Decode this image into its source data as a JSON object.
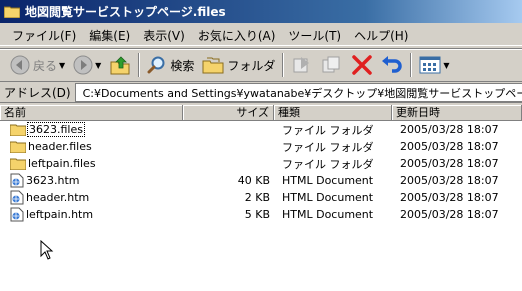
{
  "window": {
    "title": "地図閲覧サービストップページ.files"
  },
  "menu": [
    {
      "label": "ファイル(F)"
    },
    {
      "label": "編集(E)"
    },
    {
      "label": "表示(V)"
    },
    {
      "label": "お気に入り(A)"
    },
    {
      "label": "ツール(T)"
    },
    {
      "label": "ヘルプ(H)"
    }
  ],
  "toolbar": {
    "back_label": "戻る",
    "search_label": "検索",
    "folder_label": "フォルダ"
  },
  "address": {
    "label": "アドレス(D)",
    "path": "C:¥Documents and Settings¥ywatanabe¥デスクトップ¥地図閲覧サービストップページ.files"
  },
  "columns": {
    "name": "名前",
    "size": "サイズ",
    "type": "種類",
    "modified": "更新日時"
  },
  "files": [
    {
      "name": "3623.files",
      "size": "",
      "type": "ファイル フォルダ",
      "modified": "2005/03/28 18:07",
      "icon": "folder-icon"
    },
    {
      "name": "header.files",
      "size": "",
      "type": "ファイル フォルダ",
      "modified": "2005/03/28 18:07",
      "icon": "folder-icon"
    },
    {
      "name": "leftpain.files",
      "size": "",
      "type": "ファイル フォルダ",
      "modified": "2005/03/28 18:07",
      "icon": "folder-icon"
    },
    {
      "name": "3623.htm",
      "size": "40 KB",
      "type": "HTML Document",
      "modified": "2005/03/28 18:07",
      "icon": "html-document-icon"
    },
    {
      "name": "header.htm",
      "size": "2 KB",
      "type": "HTML Document",
      "modified": "2005/03/28 18:07",
      "icon": "html-document-icon"
    },
    {
      "name": "leftpain.htm",
      "size": "5 KB",
      "type": "HTML Document",
      "modified": "2005/03/28 18:07",
      "icon": "html-document-icon"
    }
  ],
  "colors": {
    "title_bar_start": "#0a246a",
    "title_bar_end": "#a6caf0",
    "chrome": "#d4d0c8",
    "folder": "#f5d36b",
    "delete_red": "#e02020",
    "undo_blue": "#1f5fd0"
  }
}
